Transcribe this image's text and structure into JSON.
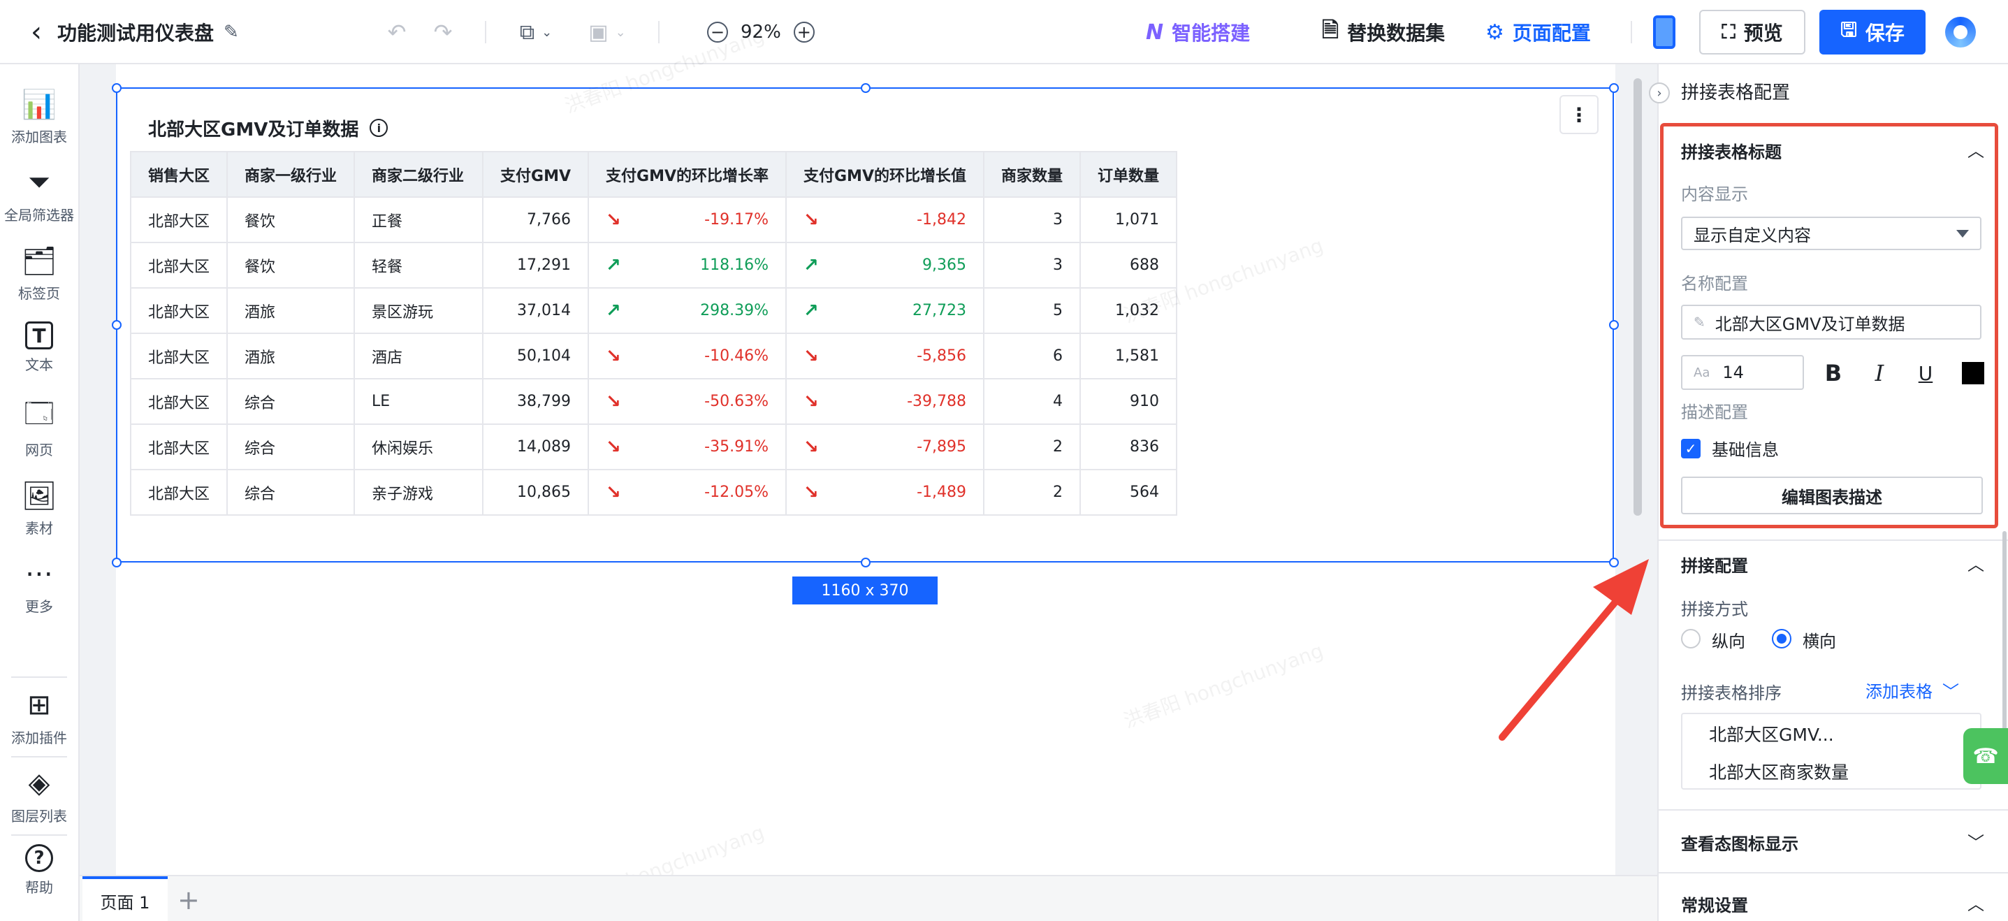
{
  "topbar": {
    "title": "功能测试用仪表盘",
    "zoom_value": "92%",
    "ai_label": "智能搭建",
    "swap_dataset_label": "替换数据集",
    "page_config_label": "页面配置",
    "preview_label": "预览",
    "save_label": "保存"
  },
  "leftbar": {
    "items": [
      {
        "label": "添加图表"
      },
      {
        "label": "全局筛选器"
      },
      {
        "label": "标签页"
      },
      {
        "label": "文本"
      },
      {
        "label": "网页"
      },
      {
        "label": "素材"
      },
      {
        "label": "更多"
      },
      {
        "label": "添加插件"
      },
      {
        "label": "图层列表"
      },
      {
        "label": "帮助"
      }
    ]
  },
  "chart": {
    "title": "北部大区GMV及订单数据",
    "size_badge": "1160 x 370",
    "columns": [
      "销售大区",
      "商家一级行业",
      "商家二级行业",
      "支付GMV",
      "支付GMV的环比增长率",
      "支付GMV的环比增长值",
      "商家数量",
      "订单数量"
    ],
    "rows": [
      {
        "region": "北部大区",
        "ind1": "餐饮",
        "ind2": "正餐",
        "gmv": "7,766",
        "rate": "-19.17%",
        "delta": "-1,842",
        "merchants": "3",
        "orders": "1,071",
        "dir": "down"
      },
      {
        "region": "北部大区",
        "ind1": "餐饮",
        "ind2": "轻餐",
        "gmv": "17,291",
        "rate": "118.16%",
        "delta": "9,365",
        "merchants": "3",
        "orders": "688",
        "dir": "up"
      },
      {
        "region": "北部大区",
        "ind1": "酒旅",
        "ind2": "景区游玩",
        "gmv": "37,014",
        "rate": "298.39%",
        "delta": "27,723",
        "merchants": "5",
        "orders": "1,032",
        "dir": "up"
      },
      {
        "region": "北部大区",
        "ind1": "酒旅",
        "ind2": "酒店",
        "gmv": "50,104",
        "rate": "-10.46%",
        "delta": "-5,856",
        "merchants": "6",
        "orders": "1,581",
        "dir": "down"
      },
      {
        "region": "北部大区",
        "ind1": "综合",
        "ind2": "LE",
        "gmv": "38,799",
        "rate": "-50.63%",
        "delta": "-39,788",
        "merchants": "4",
        "orders": "910",
        "dir": "down"
      },
      {
        "region": "北部大区",
        "ind1": "综合",
        "ind2": "休闲娱乐",
        "gmv": "14,089",
        "rate": "-35.91%",
        "delta": "-7,895",
        "merchants": "2",
        "orders": "836",
        "dir": "down"
      },
      {
        "region": "北部大区",
        "ind1": "综合",
        "ind2": "亲子游戏",
        "gmv": "10,865",
        "rate": "-12.05%",
        "delta": "-1,489",
        "merchants": "2",
        "orders": "564",
        "dir": "down"
      }
    ]
  },
  "pagebar": {
    "tab_label": "页面 1",
    "add_label": "+"
  },
  "panel": {
    "header": "拼接表格配置",
    "title_section": {
      "title": "拼接表格标题",
      "content_display_label": "内容显示",
      "content_display_value": "显示自定义内容",
      "name_config_label": "名称配置",
      "name_value": "北部大区GMV及订单数据",
      "font_size": "14",
      "desc_config_label": "描述配置",
      "basic_info_label": "基础信息",
      "edit_desc_button": "编辑图表描述"
    },
    "concat_section": {
      "title": "拼接配置",
      "method_label": "拼接方式",
      "vertical_label": "纵向",
      "horizontal_label": "横向",
      "order_label": "拼接表格排序",
      "add_table_label": "添加表格",
      "order_items": [
        "北部大区GMV...",
        "北部大区商家数量"
      ]
    },
    "viewstate_section": {
      "title": "查看态图标显示"
    },
    "general_section": {
      "title": "常规设置"
    }
  },
  "colors": {
    "accent": "#1664ff",
    "negative": "#e0312a",
    "positive": "#0f9d58",
    "highlight_box": "#e74c3c"
  }
}
